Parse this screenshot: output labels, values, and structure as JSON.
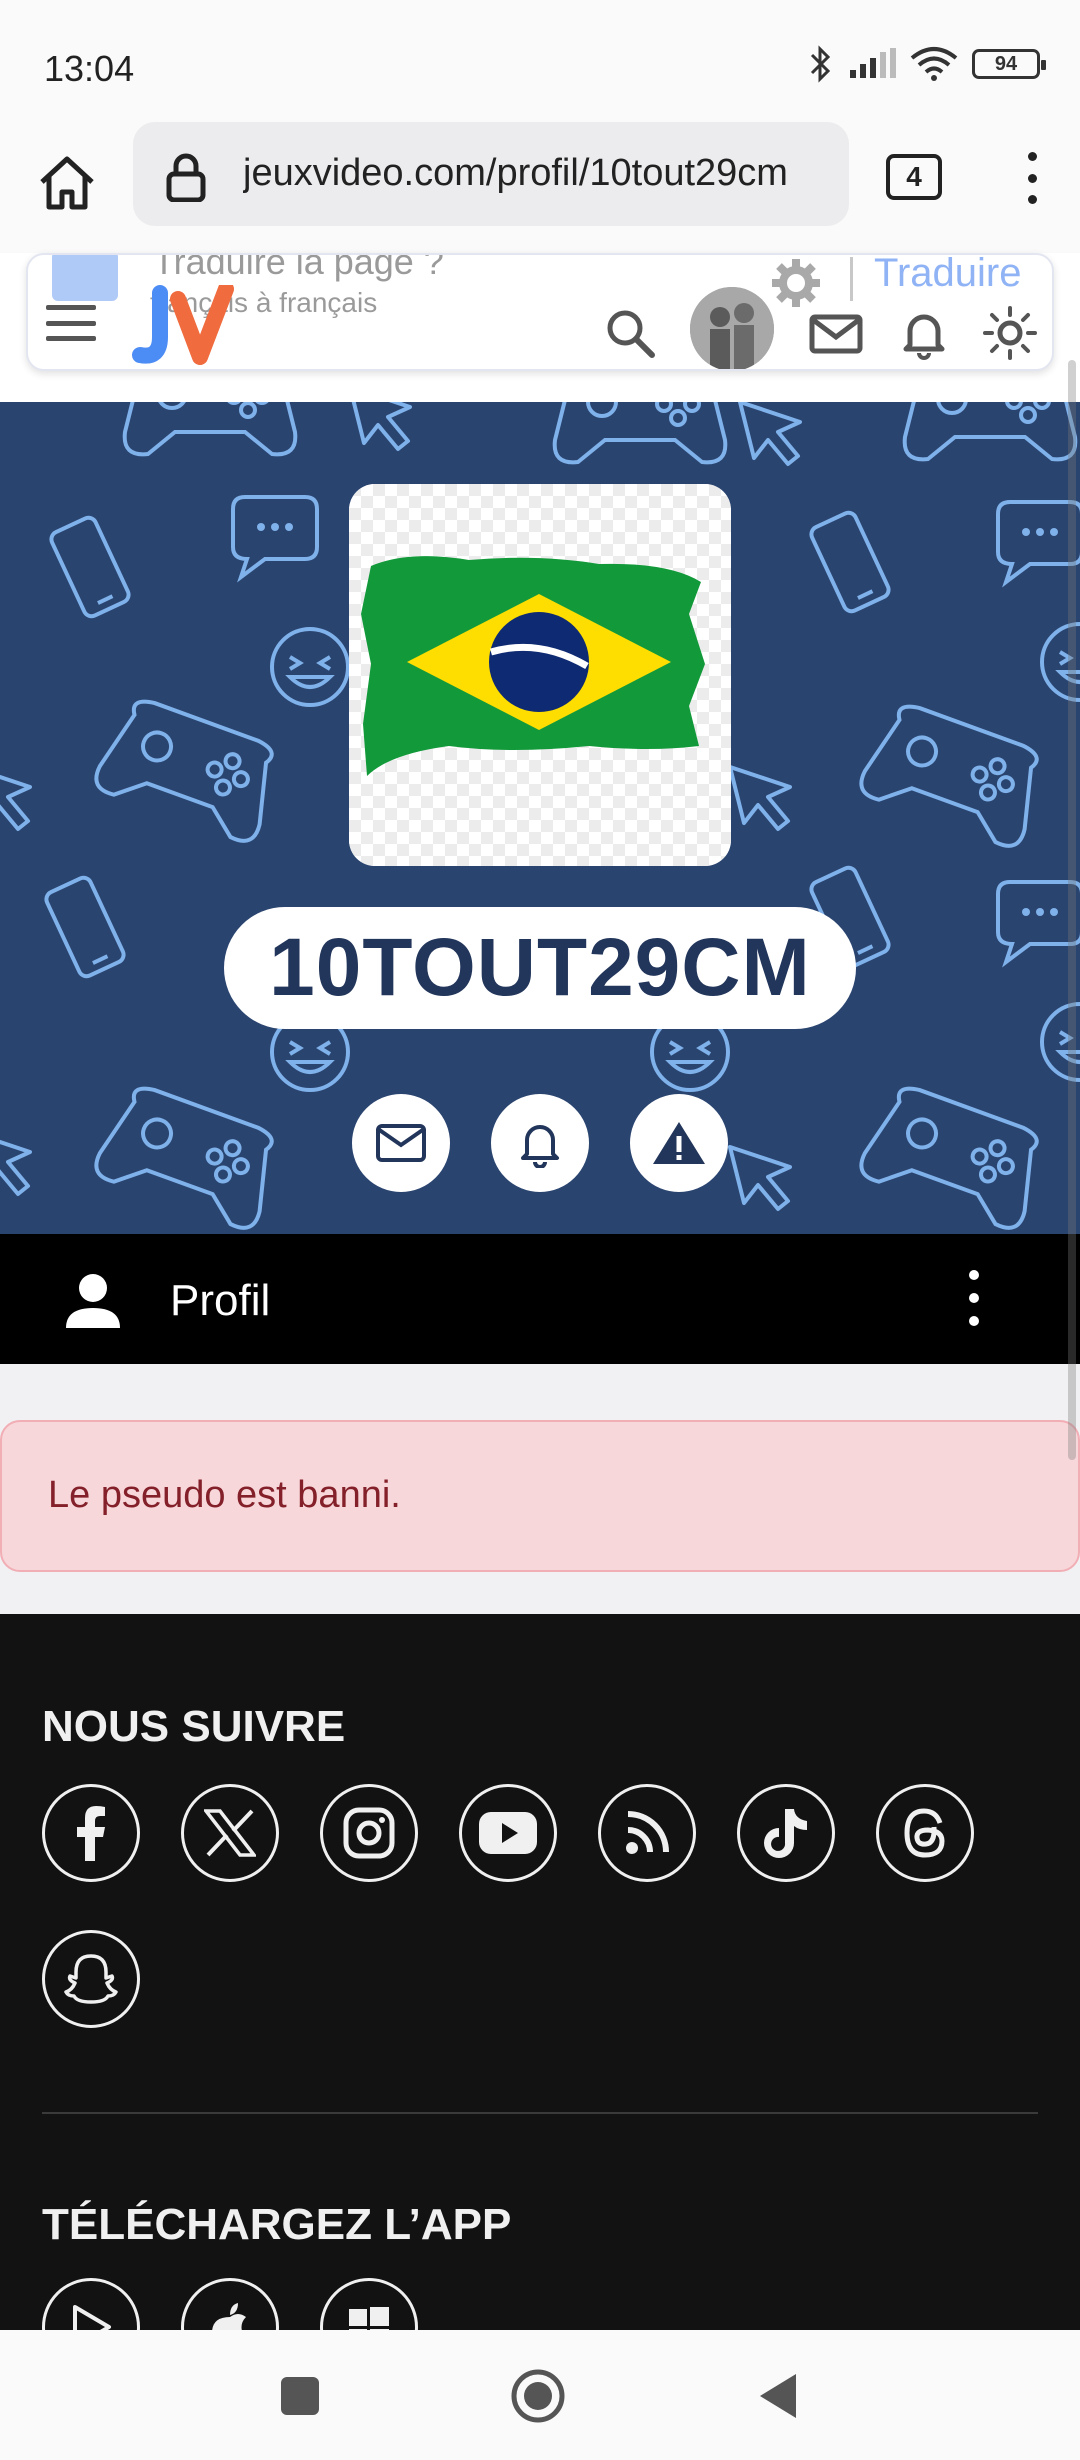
{
  "status_bar": {
    "time": "13:04",
    "battery": "94"
  },
  "browser": {
    "url": "jeuxvideo.com/profil/10tout29cm",
    "tab_count": "4"
  },
  "translate_prompt": {
    "title": "Traduire la page ?",
    "subtitle": "français à français",
    "action": "Traduire"
  },
  "site_header": {
    "logo_text": "JV"
  },
  "profile": {
    "pseudo": "10TOUT29CM",
    "section_label": "Profil",
    "banned_message": "Le pseudo est banni."
  },
  "footer": {
    "follow_heading": "NOUS SUIVRE",
    "social_icons": [
      "facebook-icon",
      "x-icon",
      "instagram-icon",
      "youtube-icon",
      "rss-icon",
      "tiktok-icon",
      "threads-icon",
      "snapchat-icon"
    ],
    "app_heading": "TÉLÉCHARGEZ L’APP",
    "app_icons": [
      "google-play-icon",
      "apple-icon",
      "windows-icon"
    ]
  },
  "colors": {
    "banner": "#2a4470",
    "pattern": "#7fb1ea",
    "pseudo_text": "#22355a",
    "alert_bg": "#f8d7da",
    "alert_text": "#842029",
    "footer_bg": "#121212",
    "logo_blue": "#4c8cf5",
    "logo_orange": "#f06b3d"
  }
}
